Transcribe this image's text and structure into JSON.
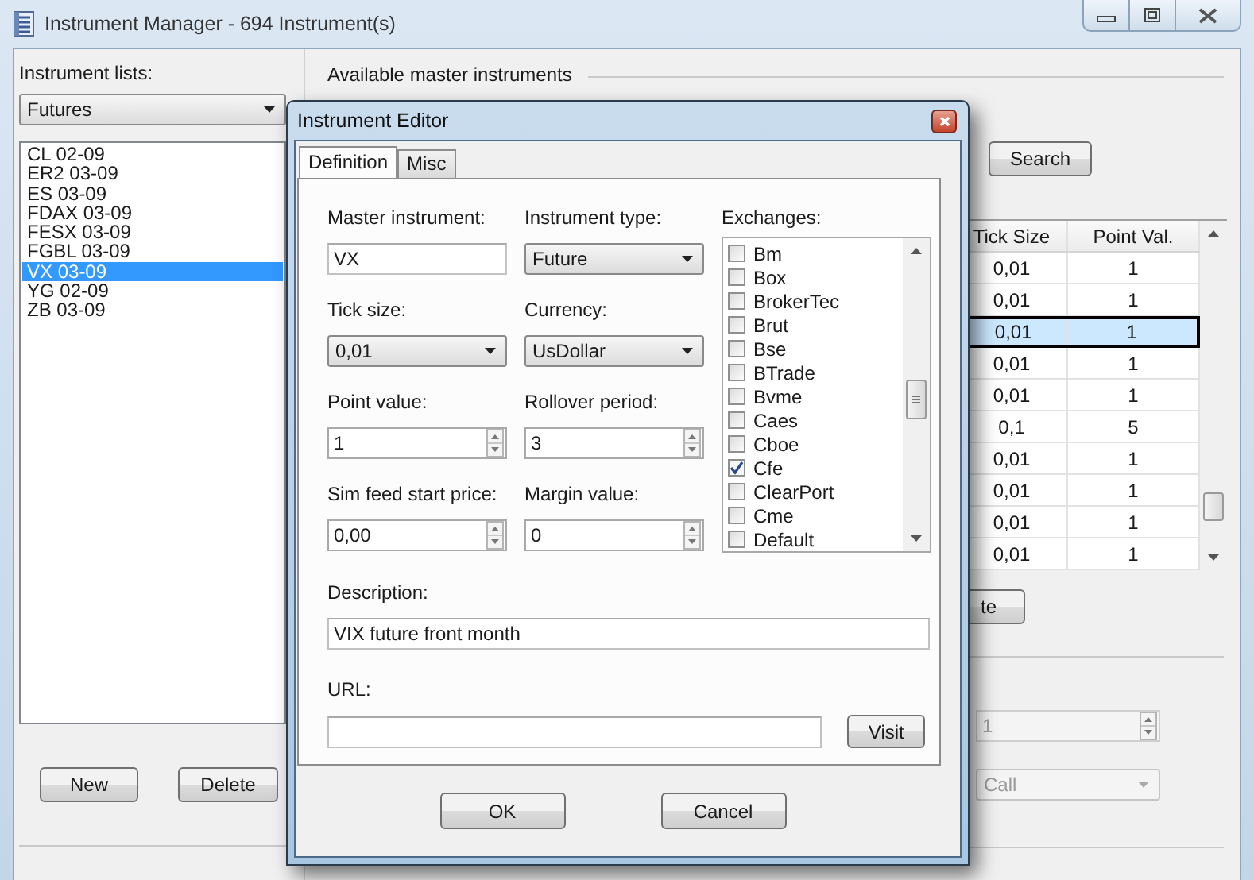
{
  "window": {
    "title": "Instrument Manager - 694 Instrument(s)"
  },
  "instrument_lists": {
    "label": "Instrument lists:",
    "selected_list": "Futures",
    "items": [
      {
        "label": "CL 02-09",
        "selected": false
      },
      {
        "label": "ER2 03-09",
        "selected": false
      },
      {
        "label": "ES 03-09",
        "selected": false
      },
      {
        "label": "FDAX 03-09",
        "selected": false
      },
      {
        "label": "FESX 03-09",
        "selected": false
      },
      {
        "label": "FGBL 03-09",
        "selected": false
      },
      {
        "label": "VX 03-09",
        "selected": true
      },
      {
        "label": "YG 02-09",
        "selected": false
      },
      {
        "label": "ZB 03-09",
        "selected": false
      }
    ],
    "buttons": [
      "New",
      "Delete"
    ]
  },
  "master_instruments": {
    "heading": "Available master instruments",
    "search_button": "Search",
    "table": {
      "columns": [
        "Tick Size",
        "Point Val."
      ],
      "rows": [
        {
          "cells": [
            "0,01",
            "1"
          ],
          "selected": false
        },
        {
          "cells": [
            "0,01",
            "1"
          ],
          "selected": false
        },
        {
          "cells": [
            "0,01",
            "1"
          ],
          "selected": true
        },
        {
          "cells": [
            "0,01",
            "1"
          ],
          "selected": false
        },
        {
          "cells": [
            "0,01",
            "1"
          ],
          "selected": false
        },
        {
          "cells": [
            "0,1",
            "5"
          ],
          "selected": false
        },
        {
          "cells": [
            "0,01",
            "1"
          ],
          "selected": false
        },
        {
          "cells": [
            "0,01",
            "1"
          ],
          "selected": false
        },
        {
          "cells": [
            "0,01",
            "1"
          ],
          "selected": false
        },
        {
          "cells": [
            "0,01",
            "1"
          ],
          "selected": false
        }
      ]
    },
    "partial_button": "te",
    "spinner": {
      "value": "1",
      "disabled": true
    },
    "dropdown": {
      "value": "Call",
      "disabled": true
    }
  },
  "dialog": {
    "title": "Instrument Editor",
    "tabs": [
      {
        "label": "Definition",
        "selected": true
      },
      {
        "label": "Misc",
        "selected": false
      }
    ],
    "fields": [
      {
        "kind": "text",
        "label": "Master instrument:",
        "value": "VX"
      },
      {
        "kind": "dropdown",
        "label": "Instrument type:",
        "value": "Future"
      },
      {
        "kind": "dropdown",
        "label": "Tick size:",
        "value": "0,01"
      },
      {
        "kind": "dropdown",
        "label": "Currency:",
        "value": "UsDollar"
      },
      {
        "kind": "spinner",
        "label": "Point value:",
        "value": "1"
      },
      {
        "kind": "spinner",
        "label": "Rollover period:",
        "value": "3"
      },
      {
        "kind": "spinner",
        "label": "Sim feed start price:",
        "value": "0,00"
      },
      {
        "kind": "spinner",
        "label": "Margin value:",
        "value": "0"
      }
    ],
    "exchanges": {
      "label": "Exchanges:",
      "items": [
        {
          "label": "Bm",
          "checked": false
        },
        {
          "label": "Box",
          "checked": false
        },
        {
          "label": "BrokerTec",
          "checked": false
        },
        {
          "label": "Brut",
          "checked": false
        },
        {
          "label": "Bse",
          "checked": false
        },
        {
          "label": "BTrade",
          "checked": false
        },
        {
          "label": "Bvme",
          "checked": false
        },
        {
          "label": "Caes",
          "checked": false
        },
        {
          "label": "Cboe",
          "checked": false
        },
        {
          "label": "Cfe",
          "checked": true
        },
        {
          "label": "ClearPort",
          "checked": false
        },
        {
          "label": "Cme",
          "checked": false
        },
        {
          "label": "Default",
          "checked": false
        }
      ]
    },
    "description": {
      "label": "Description:",
      "value": "VIX future front month"
    },
    "url": {
      "label": "URL:",
      "button": "Visit"
    },
    "buttons": [
      "OK",
      "Cancel"
    ]
  }
}
